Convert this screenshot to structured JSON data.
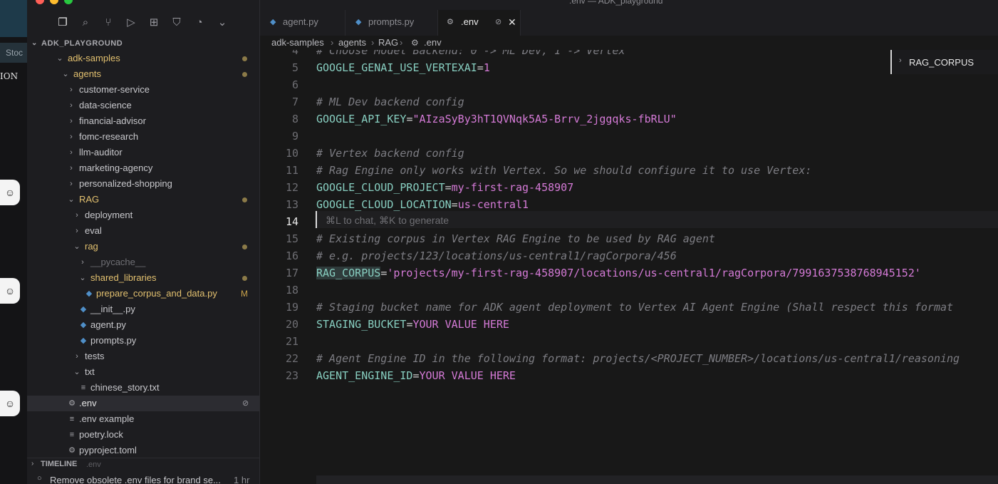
{
  "window_title": ".env — ADK_playground",
  "explorer": {
    "root": "ADK_PLAYGROUND",
    "items": [
      {
        "label": "adk-samples",
        "depth": 1,
        "type": "folder",
        "open": true,
        "color": "#e2c06f",
        "dot": true
      },
      {
        "label": "agents",
        "depth": 2,
        "type": "folder",
        "open": true,
        "color": "#e2c06f",
        "dot": true
      },
      {
        "label": "customer-service",
        "depth": 3,
        "type": "folder",
        "open": false,
        "color": "#c8c8cc"
      },
      {
        "label": "data-science",
        "depth": 3,
        "type": "folder",
        "open": false,
        "color": "#c8c8cc"
      },
      {
        "label": "financial-advisor",
        "depth": 3,
        "type": "folder",
        "open": false,
        "color": "#c8c8cc"
      },
      {
        "label": "fomc-research",
        "depth": 3,
        "type": "folder",
        "open": false,
        "color": "#c8c8cc"
      },
      {
        "label": "llm-auditor",
        "depth": 3,
        "type": "folder",
        "open": false,
        "color": "#c8c8cc"
      },
      {
        "label": "marketing-agency",
        "depth": 3,
        "type": "folder",
        "open": false,
        "color": "#c8c8cc"
      },
      {
        "label": "personalized-shopping",
        "depth": 3,
        "type": "folder",
        "open": false,
        "color": "#c8c8cc"
      },
      {
        "label": "RAG",
        "depth": 3,
        "type": "folder",
        "open": true,
        "color": "#e2c06f",
        "dot": true
      },
      {
        "label": "deployment",
        "depth": 4,
        "type": "folder",
        "open": false,
        "color": "#c8c8cc"
      },
      {
        "label": "eval",
        "depth": 4,
        "type": "folder",
        "open": false,
        "color": "#c8c8cc"
      },
      {
        "label": "rag",
        "depth": 4,
        "type": "folder",
        "open": true,
        "color": "#e2c06f",
        "dot": true
      },
      {
        "label": "__pycache__",
        "depth": 5,
        "type": "folder",
        "open": false,
        "color": "#6f6f74"
      },
      {
        "label": "shared_libraries",
        "depth": 5,
        "type": "folder",
        "open": true,
        "color": "#e2c06f",
        "dot": true
      },
      {
        "label": "prepare_corpus_and_data.py",
        "depth": 6,
        "type": "py",
        "color": "#e2c06f",
        "mod": "M"
      },
      {
        "label": "__init__.py",
        "depth": 5,
        "type": "py",
        "color": "#c8c8cc"
      },
      {
        "label": "agent.py",
        "depth": 5,
        "type": "py",
        "color": "#c8c8cc"
      },
      {
        "label": "prompts.py",
        "depth": 5,
        "type": "py",
        "color": "#c8c8cc"
      },
      {
        "label": "tests",
        "depth": 4,
        "type": "folder",
        "open": false,
        "color": "#c8c8cc"
      },
      {
        "label": "txt",
        "depth": 4,
        "type": "folder",
        "open": true,
        "color": "#c8c8cc"
      },
      {
        "label": "chinese_story.txt",
        "depth": 5,
        "type": "txt",
        "color": "#c8c8cc"
      },
      {
        "label": ".env",
        "depth": 3,
        "type": "gear",
        "color": "#e6e6e6",
        "selected": true,
        "nosync": true
      },
      {
        "label": ".env example",
        "depth": 3,
        "type": "txt",
        "color": "#c8c8cc"
      },
      {
        "label": "poetry.lock",
        "depth": 3,
        "type": "txt",
        "color": "#c8c8cc"
      },
      {
        "label": "pyproject.toml",
        "depth": 3,
        "type": "gear",
        "color": "#c8c8cc"
      }
    ],
    "timeline_title": "TIMELINE",
    "timeline_file": ".env",
    "timeline_entry": "Remove obsolete .env files for brand se...",
    "timeline_age": "1 hr"
  },
  "tabs": [
    {
      "label": "agent.py",
      "active": false
    },
    {
      "label": "prompts.py",
      "active": false
    },
    {
      "label": ".env",
      "active": true
    }
  ],
  "breadcrumb": [
    "adk-samples",
    "agents",
    "RAG",
    ".env"
  ],
  "find_widget": {
    "value": "RAG_CORPUS"
  },
  "editor": {
    "current_line": 14,
    "inline_hint": "⌘L to chat, ⌘K to generate",
    "lines": [
      {
        "n": "4",
        "text": "# Choose Model Backend: 0 -> ML Dev, 1 -> Vertex",
        "kind": "comment"
      },
      {
        "n": "5",
        "key": "GOOGLE_GENAI_USE_VERTEXAI",
        "value": "1"
      },
      {
        "n": "6",
        "text": ""
      },
      {
        "n": "7",
        "text": "# ML Dev backend config",
        "kind": "comment"
      },
      {
        "n": "8",
        "key": "GOOGLE_API_KEY",
        "value": "\"AIzaSyBy3hT1QVNqk5A5-Brrv_2jggqks-fbRLU\""
      },
      {
        "n": "9",
        "text": ""
      },
      {
        "n": "10",
        "text": "# Vertex backend config",
        "kind": "comment"
      },
      {
        "n": "11",
        "text": "# Rag Engine only works with Vertex. So we should configure it to use Vertex:",
        "kind": "comment"
      },
      {
        "n": "12",
        "key": "GOOGLE_CLOUD_PROJECT",
        "value": "my-first-rag-458907"
      },
      {
        "n": "13",
        "key": "GOOGLE_CLOUD_LOCATION",
        "value": "us-central1"
      },
      {
        "n": "14",
        "text": ""
      },
      {
        "n": "15",
        "text": "# Existing corpus in Vertex RAG Engine to be used by RAG agent",
        "kind": "comment"
      },
      {
        "n": "16",
        "text": "# e.g. projects/123/locations/us-central1/ragCorpora/456",
        "kind": "comment"
      },
      {
        "n": "17",
        "key": "RAG_CORPUS",
        "value": "'projects/my-first-rag-458907/locations/us-central1/ragCorpora/7991637538768945152'",
        "highlight": true
      },
      {
        "n": "18",
        "text": ""
      },
      {
        "n": "19",
        "text": "# Staging bucket name for ADK agent deployment to Vertex AI Agent Engine (Shall respect this format",
        "kind": "comment"
      },
      {
        "n": "20",
        "key": "STAGING_BUCKET",
        "value": "YOUR VALUE HERE"
      },
      {
        "n": "21",
        "text": ""
      },
      {
        "n": "22",
        "text": "# Agent Engine ID in the following format: projects/<PROJECT_NUMBER>/locations/us-central1/reasoning",
        "kind": "comment"
      },
      {
        "n": "23",
        "key": "AGENT_ENGINE_ID",
        "value": "YOUR VALUE HERE"
      }
    ]
  },
  "background_app": {
    "stoc_label": "Stoc",
    "ion_label": "ION"
  },
  "colors": {
    "key": "#88cfc1",
    "value": "#d47ad6",
    "comment": "#7d7d83",
    "folder_modified": "#e2c06f"
  }
}
